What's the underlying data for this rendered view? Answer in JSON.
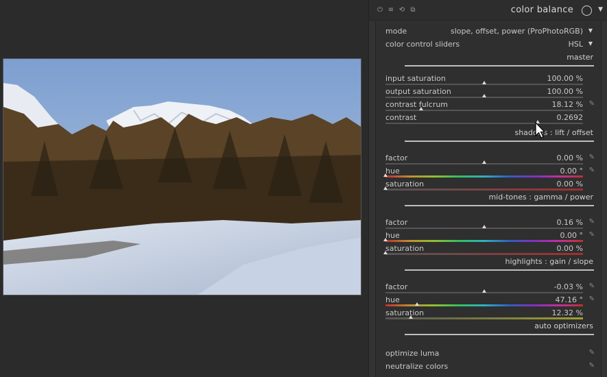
{
  "module": {
    "title": "color balance",
    "icons": [
      "power-icon",
      "presets-icon",
      "reset-icon",
      "duplicate-icon"
    ]
  },
  "mode": {
    "label": "mode",
    "value": "slope, offset, power (ProPhotoRGB)"
  },
  "sliders_mode": {
    "label": "color control sliders",
    "value": "HSL"
  },
  "sections": {
    "master": "master",
    "shadows": "shadows : lift / offset",
    "midtones": "mid-tones : gamma / power",
    "highlights": "highlights : gain / slope",
    "auto": "auto optimizers"
  },
  "master": {
    "input_saturation": {
      "label": "input saturation",
      "value": "100.00 %",
      "level": 0.5
    },
    "output_saturation": {
      "label": "output saturation",
      "value": "100.00 %",
      "level": 0.5
    },
    "contrast_fulcrum": {
      "label": "contrast fulcrum",
      "value": "18.12 %",
      "level": 0.18
    },
    "contrast": {
      "label": "contrast",
      "value": "0.2692",
      "level": 0.77
    }
  },
  "shadows": {
    "factor": {
      "label": "factor",
      "value": "0.00 %",
      "level": 0.5
    },
    "hue": {
      "label": "hue",
      "value": "0.00 °",
      "level": 0.0
    },
    "saturation": {
      "label": "saturation",
      "value": "0.00 %",
      "level": 0.0
    }
  },
  "midtones": {
    "factor": {
      "label": "factor",
      "value": "0.16 %",
      "level": 0.5
    },
    "hue": {
      "label": "hue",
      "value": "0.00 °",
      "level": 0.0
    },
    "saturation": {
      "label": "saturation",
      "value": "0.00 %",
      "level": 0.0
    }
  },
  "highlights": {
    "factor": {
      "label": "factor",
      "value": "-0.03 %",
      "level": 0.5
    },
    "hue": {
      "label": "hue",
      "value": "47.16 °",
      "level": 0.16
    },
    "saturation": {
      "label": "saturation",
      "value": "12.32 %",
      "level": 0.13
    }
  },
  "auto": {
    "optimize_luma": {
      "label": "optimize luma"
    },
    "neutralize_colors": {
      "label": "neutralize colors"
    }
  },
  "colors": {
    "panel_bg": "#333333",
    "content_bg": "#2f2f2f",
    "text": "#c9c9c9",
    "accent_line": "#bfbfbf"
  }
}
